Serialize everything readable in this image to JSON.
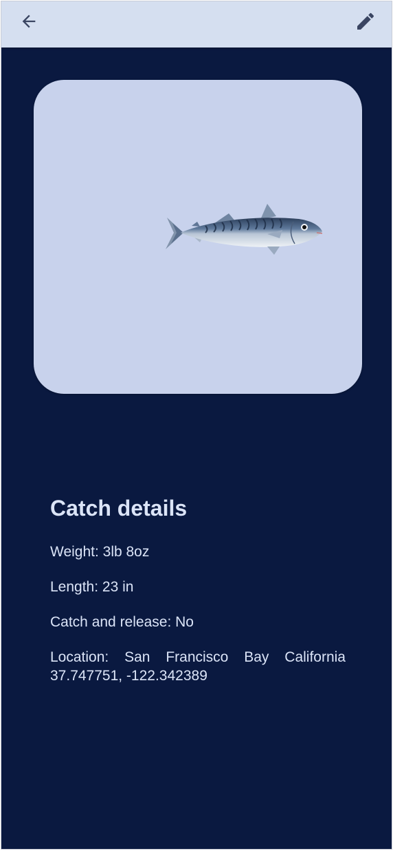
{
  "appbar": {
    "back_icon": "arrow-back-icon",
    "edit_icon": "pencil-icon"
  },
  "photo": {
    "subject": "fish-illustration"
  },
  "details": {
    "heading": "Catch details",
    "weight": "Weight: 3lb 8oz",
    "length": "Length: 23 in",
    "catch_and_release": "Catch and release: No",
    "location": "Location: San Francisco Bay California 37.747751, -122.342389"
  },
  "colors": {
    "background": "#0a1940",
    "appbar": "#d5dff0",
    "card": "#c8d2ec",
    "text": "#dbe4f7",
    "icon": "#3a4562"
  }
}
